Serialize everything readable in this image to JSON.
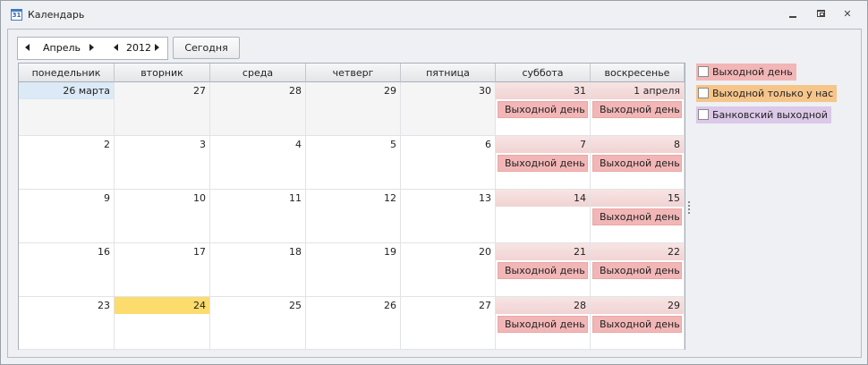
{
  "window": {
    "title": "Календарь",
    "icon_text": "31"
  },
  "navigator": {
    "month": "Апрель",
    "year": "2012",
    "today_label": "Сегодня"
  },
  "weekdays": [
    "понедельник",
    "вторник",
    "среда",
    "четверг",
    "пятница",
    "суббота",
    "воскресенье"
  ],
  "weeks": [
    [
      "26 марта",
      "27",
      "28",
      "29",
      "30",
      "31",
      "1 апреля"
    ],
    [
      "2",
      "3",
      "4",
      "5",
      "6",
      "7",
      "8"
    ],
    [
      "9",
      "10",
      "11",
      "12",
      "13",
      "14",
      "15"
    ],
    [
      "16",
      "17",
      "18",
      "19",
      "20",
      "21",
      "22"
    ],
    [
      "23",
      "24",
      "25",
      "26",
      "27",
      "28",
      "29"
    ]
  ],
  "events": [
    [
      "",
      "",
      "",
      "",
      "",
      "Выходной день",
      "Выходной день"
    ],
    [
      "",
      "",
      "",
      "",
      "",
      "Выходной день",
      "Выходной день"
    ],
    [
      "",
      "",
      "",
      "",
      "",
      "",
      "Выходной день"
    ],
    [
      "",
      "",
      "",
      "",
      "",
      "Выходной день",
      "Выходной день"
    ],
    [
      "",
      "",
      "",
      "",
      "",
      "Выходной день",
      "Выходной день"
    ]
  ],
  "today": {
    "week": 4,
    "day": 1
  },
  "legend": [
    {
      "label": "Выходной день",
      "color": "#f2b6b6"
    },
    {
      "label": "Выходной только у нас",
      "color": "#f6c58a"
    },
    {
      "label": "Банковский выходной",
      "color": "#dcc8e8"
    }
  ],
  "colors": {
    "weekend_header": "#f1d3d3",
    "today": "#fbdc6c",
    "first_day": "#dce9f6",
    "event": "#f2b6b6"
  }
}
